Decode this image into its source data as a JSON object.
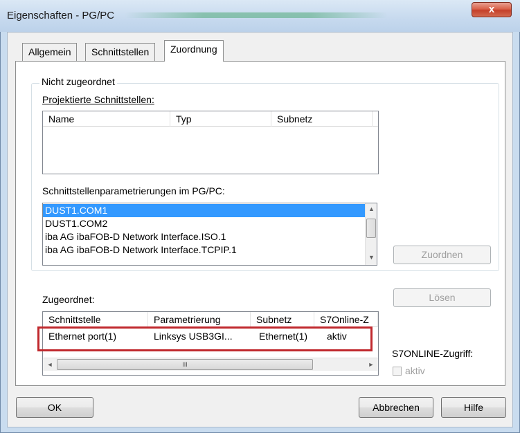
{
  "window": {
    "title": "Eigenschaften - PG/PC",
    "close_glyph": "x"
  },
  "tabs": [
    {
      "label": "Allgemein"
    },
    {
      "label": "Schnittstellen"
    },
    {
      "label": "Zuordnung"
    }
  ],
  "not_assigned": {
    "legend": "Nicht zugeordnet",
    "projected_label": "Projektierte Schnittstellen:",
    "projected_columns": [
      "Name",
      "Typ",
      "Subnetz"
    ],
    "params_label": "Schnittstellenparametrierungen im PG/PC:",
    "params_items": [
      "DUST1.COM1",
      "DUST1.COM2",
      "iba AG ibaFOB-D Network Interface.ISO.1",
      "iba AG ibaFOB-D Network Interface.TCPIP.1"
    ],
    "assign_button": "Zuordnen"
  },
  "assigned": {
    "label": "Zugeordnet:",
    "columns": [
      "Schnittstelle",
      "Parametrierung",
      "Subnetz",
      "S7Online-Z"
    ],
    "rows": [
      {
        "interface": "Ethernet port(1)",
        "param": "Linksys USB3GI...",
        "subnet": "Ethernet(1)",
        "s7online": "aktiv"
      }
    ],
    "release_button": "Lösen",
    "s7online_label": "S7ONLINE-Zugriff:",
    "active_checkbox": "aktiv"
  },
  "footer": {
    "ok": "OK",
    "cancel": "Abbrechen",
    "help": "Hilfe"
  },
  "colors": {
    "selection": "#3399ff",
    "highlight_border": "#c0282d"
  },
  "icons": {
    "scroll_up": "▲",
    "scroll_down": "▼",
    "scroll_left": "◄",
    "scroll_right": "►",
    "scroll_grip": "III"
  }
}
